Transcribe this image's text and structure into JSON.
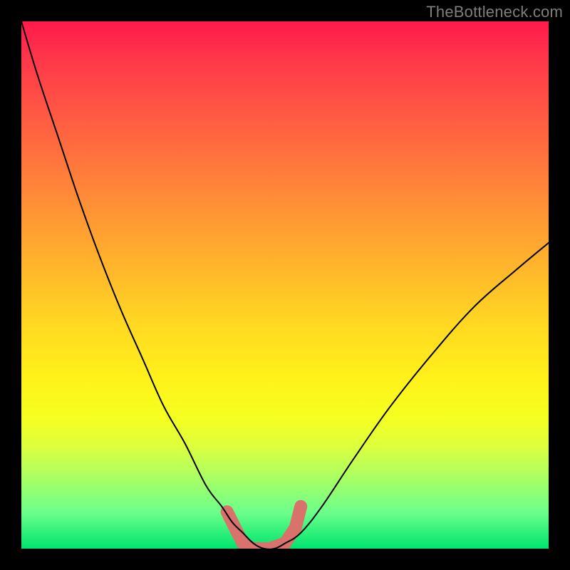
{
  "watermark": "TheBottleneck.com",
  "chart_data": {
    "type": "line",
    "title": "",
    "xlabel": "",
    "ylabel": "",
    "xlim": [
      0,
      100
    ],
    "ylim": [
      0,
      100
    ],
    "grid": false,
    "legend": false,
    "background": "rainbow-gradient (red top to green bottom)",
    "note": "Values digitised from pixel positions; y measured as percentage from bottom (0) to top (100). The valley bottom ~0-1%.",
    "series": [
      {
        "name": "bottleneck-curve",
        "x": [
          0,
          3,
          7,
          11,
          15,
          19,
          23,
          27,
          31,
          35,
          38,
          40,
          42,
          44,
          46,
          48,
          50,
          53,
          57,
          63,
          70,
          78,
          86,
          94,
          100
        ],
        "y": [
          100,
          90,
          78,
          66,
          55,
          45,
          36,
          27,
          20,
          12,
          8,
          5,
          3,
          1,
          0,
          0,
          1,
          3,
          8,
          17,
          27,
          37,
          46,
          53,
          58
        ]
      }
    ],
    "annotations": [
      {
        "name": "valley-highlight",
        "shape": "thick-polyline",
        "color": "#d8726b",
        "points_x": [
          39,
          41,
          42,
          44,
          47,
          50,
          52,
          53
        ],
        "points_y": [
          7,
          3,
          1,
          0,
          0,
          1,
          4,
          8
        ]
      }
    ]
  }
}
